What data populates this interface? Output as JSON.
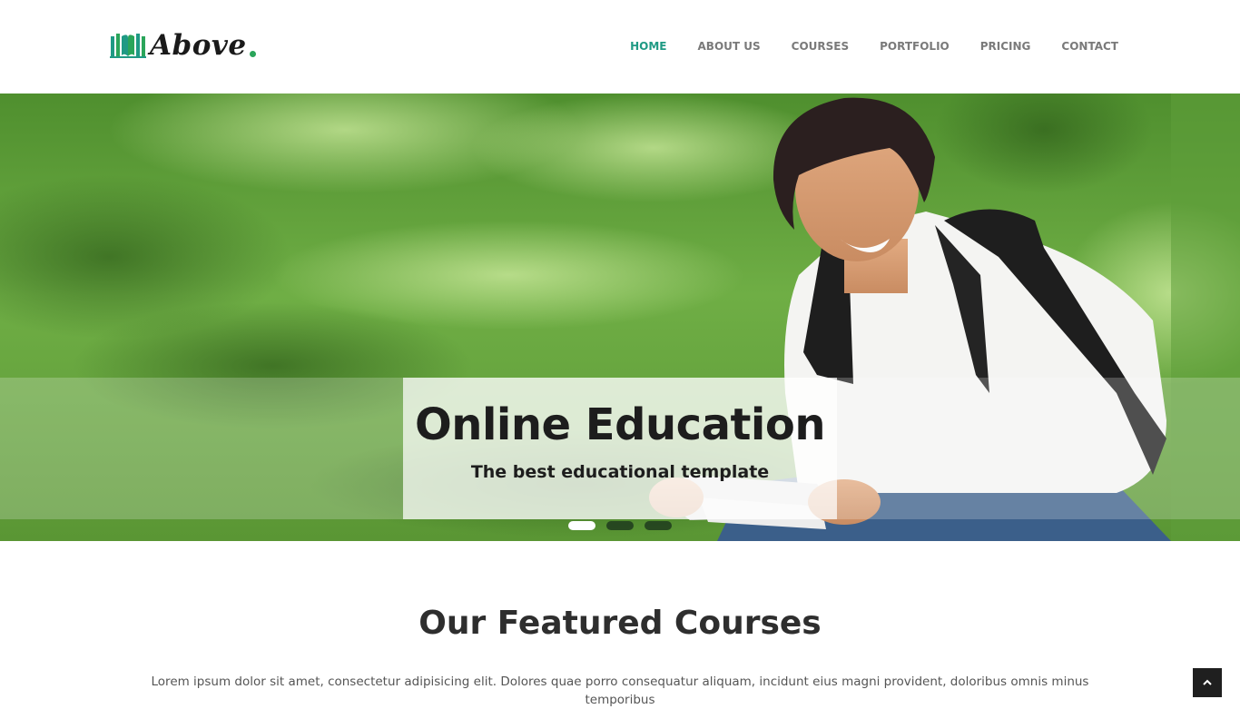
{
  "brand": {
    "name": "Above",
    "accent_color": "#1f9a84",
    "dot_color": "#2aa55a",
    "icon": "books-icon"
  },
  "nav": {
    "items": [
      {
        "label": "HOME",
        "active": true
      },
      {
        "label": "ABOUT US",
        "active": false
      },
      {
        "label": "COURSES",
        "active": false
      },
      {
        "label": "PORTFOLIO",
        "active": false
      },
      {
        "label": "PRICING",
        "active": false
      },
      {
        "label": "CONTACT",
        "active": false
      }
    ]
  },
  "hero": {
    "title": "Online Education",
    "subtitle": "The best educational template",
    "slides_count": 3,
    "active_slide": 1
  },
  "featured": {
    "title": "Our Featured Courses",
    "text": "Lorem ipsum dolor sit amet, consectetur adipisicing elit. Dolores quae porro consequatur aliquam, incidunt eius magni provident, doloribus omnis minus temporibus"
  },
  "back_to_top": {
    "icon": "chevron-up-icon"
  }
}
